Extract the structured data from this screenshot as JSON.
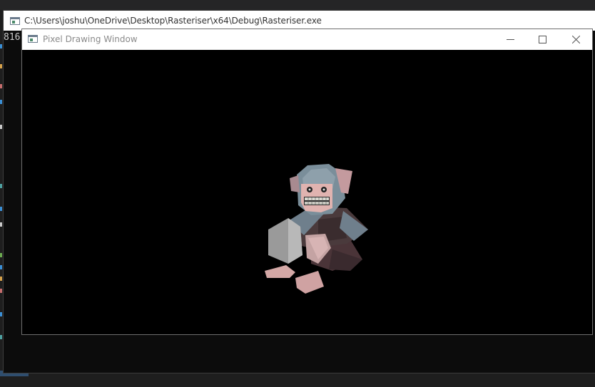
{
  "console": {
    "title": "C:\\Users\\joshu\\OneDrive\\Desktop\\Rasteriser\\x64\\Debug\\Rasteriser.exe",
    "output": "816"
  },
  "pixel_window": {
    "title": "Pixel Drawing Window",
    "buttons": {
      "minimize": "minimize",
      "maximize": "maximize",
      "close": "close"
    },
    "scene": "3D monkey model render"
  },
  "colors": {
    "background": "#1e1e1e",
    "console_bg": "#0c0c0c",
    "titlebar": "#ffffff",
    "canvas": "#000000"
  }
}
